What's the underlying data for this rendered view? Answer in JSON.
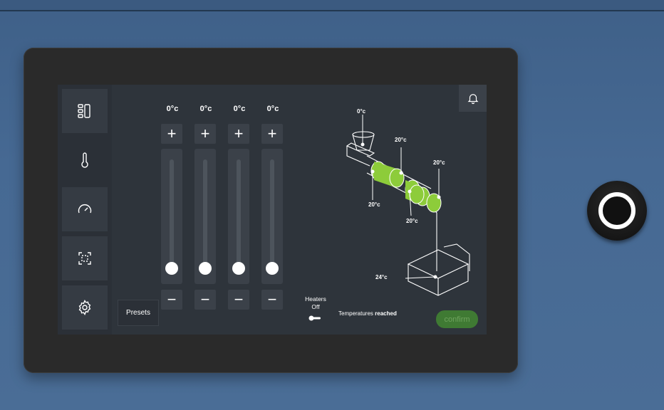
{
  "sidebar": {
    "items": [
      {
        "icon": "layout-icon",
        "active": false
      },
      {
        "icon": "thermometer-icon",
        "active": true
      },
      {
        "icon": "gauge-icon",
        "active": false
      },
      {
        "icon": "scan-icon",
        "active": false
      },
      {
        "icon": "gear-icon",
        "active": false
      }
    ]
  },
  "heaters": {
    "columns": [
      {
        "temp": "0°c",
        "plus": "+",
        "minus": "−"
      },
      {
        "temp": "0°c",
        "plus": "+",
        "minus": "−"
      },
      {
        "temp": "0°c",
        "plus": "+",
        "minus": "−"
      },
      {
        "temp": "0°c",
        "plus": "+",
        "minus": "−"
      }
    ],
    "presets_label": "Presets",
    "toggle_label_line1": "Heaters",
    "toggle_label_line2": "Off"
  },
  "diagram": {
    "labels": [
      "0°c",
      "20°c",
      "20°c",
      "20°c",
      "20°c",
      "24°c"
    ]
  },
  "status": {
    "prefix": "Temperatures",
    "emphasis": "reached"
  },
  "confirm_label": "confirm",
  "colors": {
    "accent_green": "#8dcc3a",
    "confirm_bg": "#3f7a33",
    "panel": "#2e343b",
    "frame": "#4a6d96"
  }
}
